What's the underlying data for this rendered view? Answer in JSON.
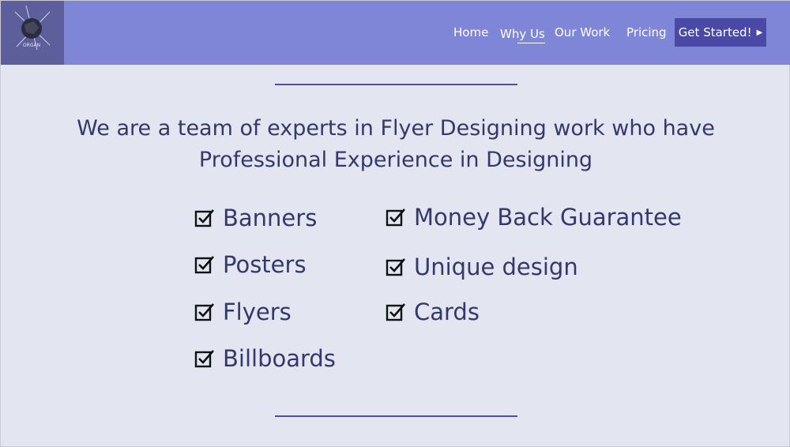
{
  "logo": {
    "text": "ORGAN"
  },
  "nav": {
    "home": "Home",
    "why_us": "Why Us",
    "our_work": "Our Work",
    "pricing": "Pricing",
    "cta": "Get Started!",
    "cta_icon": "play-triangle-icon"
  },
  "main": {
    "heading_line1": "We are a team of experts in Flyer Designing work who have",
    "heading_line2": "Professional Experience in Designing",
    "features_left": [
      "Banners",
      "Posters",
      "Flyers",
      "Billboards"
    ],
    "features_right": [
      "Money Back Guarantee",
      "Unique design",
      "Cards"
    ]
  },
  "colors": {
    "navbar": "#7f86d8",
    "logo_bg": "#5d5f9c",
    "cta_bg": "#4a4aa6",
    "page_bg": "#e3e6f1",
    "text": "#35386b"
  }
}
